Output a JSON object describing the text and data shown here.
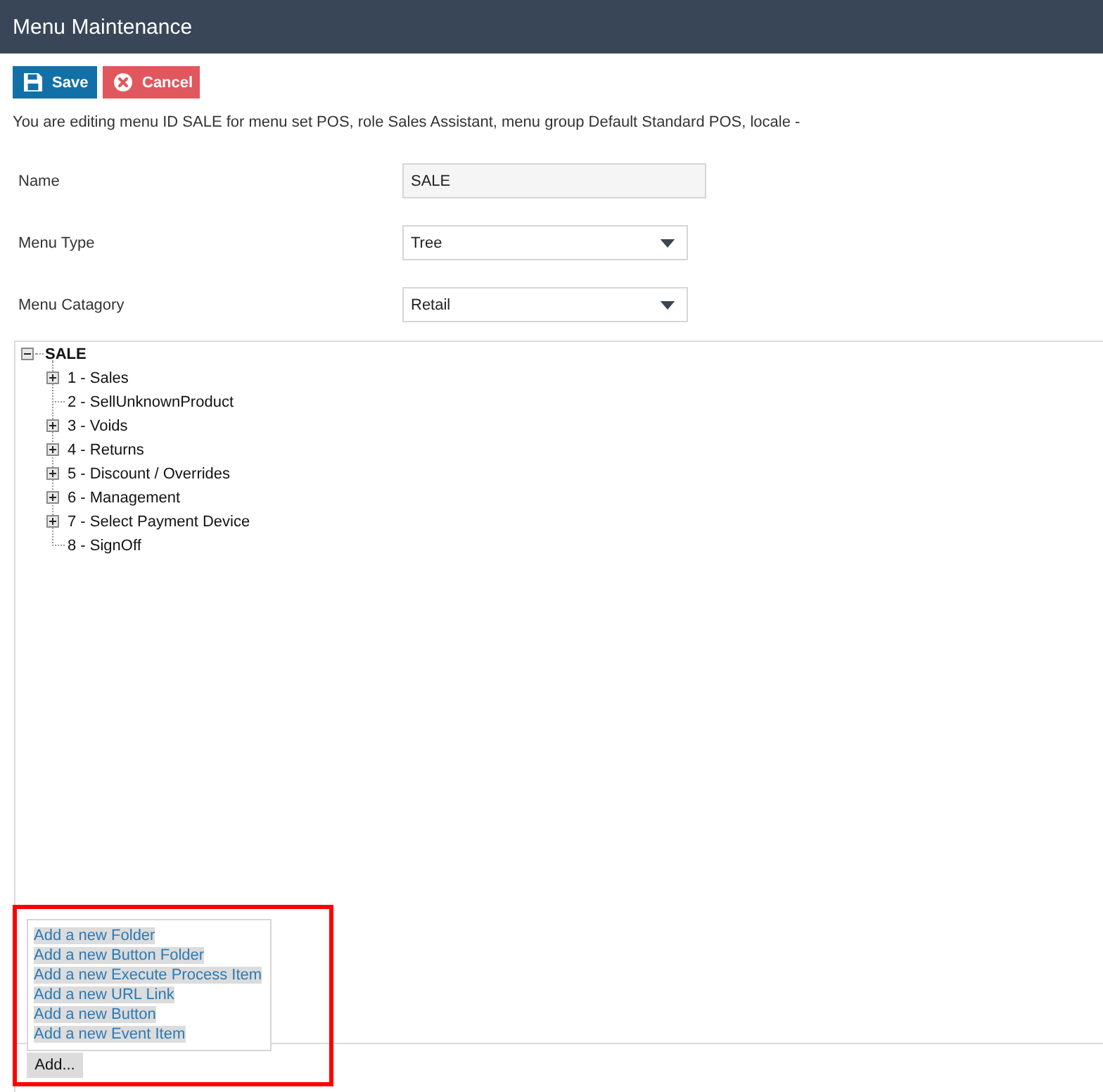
{
  "window": {
    "title": "Menu Maintenance"
  },
  "toolbar": {
    "buttons": [
      {
        "kind": "save",
        "label": "Save"
      },
      {
        "kind": "cancel",
        "label": "Cancel"
      }
    ]
  },
  "info": "You are editing menu ID SALE for menu set POS, role Sales Assistant, menu group Default Standard POS, locale -",
  "form": {
    "fields": [
      {
        "kind": "text",
        "label": "Name",
        "value": "SALE"
      },
      {
        "kind": "select",
        "label": "Menu Type",
        "value": "Tree"
      },
      {
        "kind": "select",
        "label": "Menu Catagory",
        "value": "Retail"
      }
    ]
  },
  "tree": {
    "root": {
      "label": "SALE",
      "expanded": true,
      "children": [
        {
          "kind": "folder",
          "label": "1 - Sales",
          "expanded": false
        },
        {
          "kind": "leaf",
          "label": "2 - SellUnknownProduct"
        },
        {
          "kind": "folder",
          "label": "3 - Voids",
          "expanded": false
        },
        {
          "kind": "folder",
          "label": "4 - Returns",
          "expanded": false
        },
        {
          "kind": "folder",
          "label": "5 - Discount / Overrides",
          "expanded": false
        },
        {
          "kind": "folder",
          "label": "6 - Management",
          "expanded": false
        },
        {
          "kind": "folder",
          "label": "7 - Select Payment Device",
          "expanded": false
        },
        {
          "kind": "leaf",
          "label": "8 - SignOff"
        }
      ]
    }
  },
  "add_menu": {
    "items": [
      "Add a new Folder",
      "Add a new Button Folder",
      "Add a new Execute Process Item",
      "Add a new URL Link",
      "Add a new Button",
      "Add a new Event Item"
    ],
    "button": "Add..."
  }
}
